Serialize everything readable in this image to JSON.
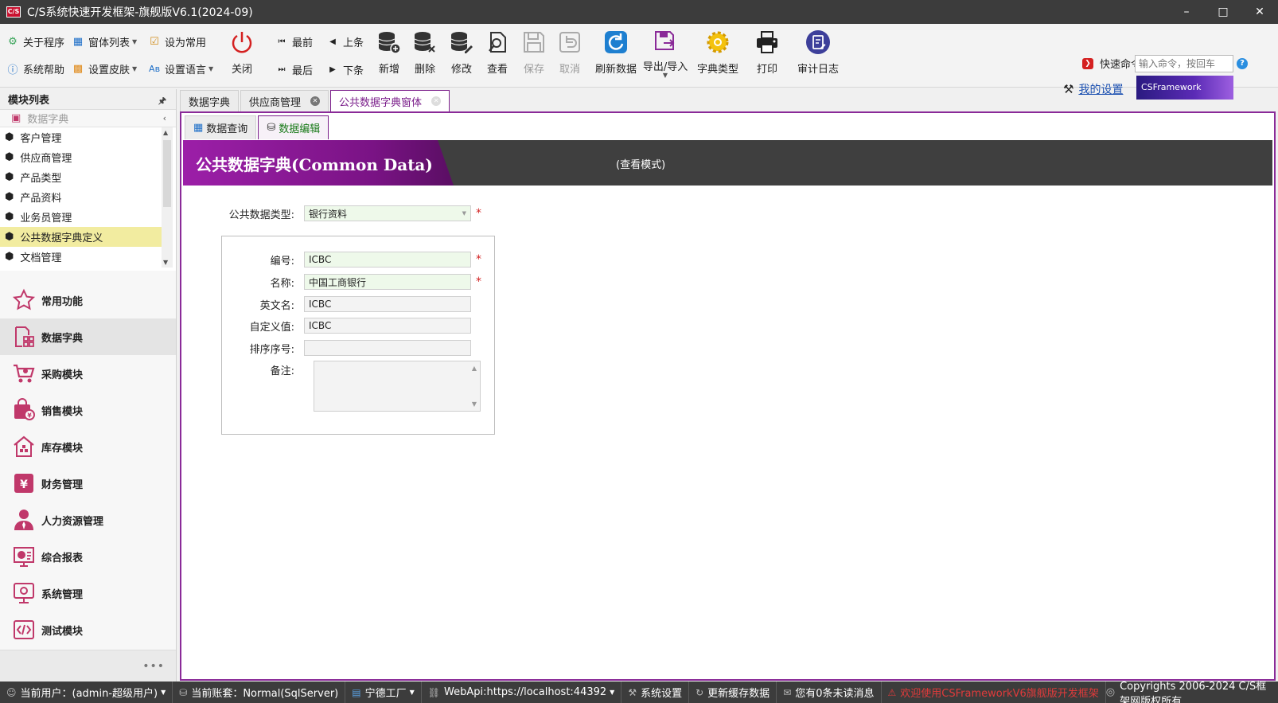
{
  "window": {
    "title": "C/S系统快速开发框架-旗舰版V6.1(2024-09)",
    "app_icon_text": "C/S"
  },
  "ribbon": {
    "small_buttons": {
      "about": "关于程序",
      "window_list": "窗体列表",
      "set_common": "设为常用",
      "system_help": "系统帮助",
      "set_skin": "设置皮肤",
      "set_language": "设置语言"
    },
    "close": "关闭",
    "first": "最前",
    "prev": "上条",
    "last": "最后",
    "next": "下条",
    "add": "新增",
    "delete": "删除",
    "edit": "修改",
    "view": "查看",
    "save": "保存",
    "cancel": "取消",
    "refresh": "刷新数据",
    "import_export": "导出/导入",
    "dict_type": "字典类型",
    "print": "打印",
    "audit_log": "审计日志",
    "quick_command_label": "快速命令:",
    "quick_command_placeholder": "输入命令，按回车",
    "help_badge": "?",
    "my_settings": "我的设置",
    "brand": "CSFramework"
  },
  "left_panel": {
    "header": "模块列表",
    "group": "数据字典",
    "items": [
      {
        "label": "客户管理"
      },
      {
        "label": "供应商管理"
      },
      {
        "label": "产品类型"
      },
      {
        "label": "产品资料"
      },
      {
        "label": "业务员管理"
      },
      {
        "label": "公共数据字典定义"
      },
      {
        "label": "文档管理"
      }
    ],
    "nav": [
      {
        "label": "常用功能"
      },
      {
        "label": "数据字典"
      },
      {
        "label": "采购模块"
      },
      {
        "label": "销售模块"
      },
      {
        "label": "库存模块"
      },
      {
        "label": "财务管理"
      },
      {
        "label": "人力资源管理"
      },
      {
        "label": "综合报表"
      },
      {
        "label": "系统管理"
      },
      {
        "label": "测试模块"
      }
    ],
    "more": "•••"
  },
  "doc_tabs": [
    {
      "label": "数据字典"
    },
    {
      "label": "供应商管理"
    },
    {
      "label": "公共数据字典窗体"
    }
  ],
  "sub_tabs": [
    {
      "label": "数据查询"
    },
    {
      "label": "数据编辑"
    }
  ],
  "form": {
    "title": "公共数据字典(Common Data)",
    "mode": "(查看模式)",
    "type_label": "公共数据类型:",
    "type_value": "银行资料",
    "code_label": "编号:",
    "code_value": "ICBC",
    "name_label": "名称:",
    "name_value": "中国工商银行",
    "en_label": "英文名:",
    "en_value": "ICBC",
    "custom_label": "自定义值:",
    "custom_value": "ICBC",
    "sort_label": "排序序号:",
    "sort_value": "",
    "remark_label": "备注:",
    "remark_value": "",
    "required_mark": "*"
  },
  "status_bar": {
    "user": "当前用户：(admin-超级用户)",
    "account": "当前账套：Normal(SqlServer)",
    "factory": "宁德工厂",
    "webapi": "WebApi:https://localhost:44392",
    "settings": "系统设置",
    "update_cache": "更新缓存数据",
    "messages": "您有0条未读消息",
    "welcome": "欢迎使用CSFrameworkV6旗舰版开发框架",
    "copyright": "Copyrights 2006-2024 C/S框架网版权所有"
  },
  "colors": {
    "accent_purple": "#8a2a98",
    "header_dark": "#3f3f3f",
    "selected_item": "#f2eca0",
    "required_star": "#d21f1f"
  }
}
